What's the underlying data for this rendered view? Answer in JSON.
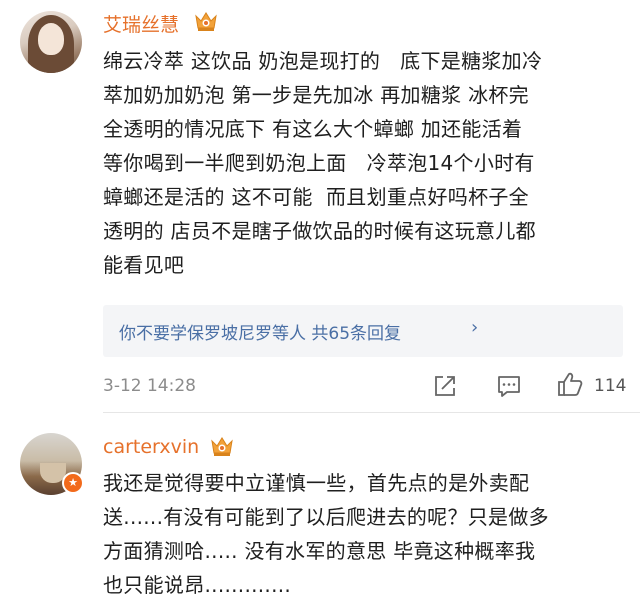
{
  "comments": [
    {
      "username": "艾瑞丝慧",
      "text_lines": [
        "绵云冷萃 这饮品 奶泡是现打的   底下是糖浆加冷",
        "萃加奶加奶泡 第一步是先加冰 再加糖浆 冰杯完",
        "全透明的情况底下 有这么大个蟑螂 加还能活着",
        "等你喝到一半爬到奶泡上面   冷萃泡14个小时有",
        "蟑螂还是活的 这不可能  而且划重点好吗杯子全",
        "透明的 店员不是瞎子做饮品的时候有这玩意儿都",
        "能看见吧"
      ],
      "reply_summary": "你不要学保罗坡尼罗等人  共65条回复",
      "timestamp": "3-12 14:28",
      "like_count": "114"
    },
    {
      "username": "carterxvin",
      "text_lines": [
        "我还是觉得要中立谨慎一些，首先点的是外卖配",
        "送......有没有可能到了以后爬进去的呢？只是做多",
        "方面猜测哈..... 没有水军的意思 毕竟这种概率我",
        "也只能说昂............."
      ]
    }
  ],
  "icons": {
    "crown": "vip-crown-icon",
    "share": "share-icon",
    "comment": "comment-icon",
    "like": "thumbs-up-icon",
    "reply_chevron": "chevron-right-icon",
    "verified": "verified-badge-icon"
  },
  "colors": {
    "username": "#e6712b",
    "reply_link": "#4a6fa5",
    "meta_text": "#8c8c8c",
    "reply_bg": "#f4f5f7"
  }
}
